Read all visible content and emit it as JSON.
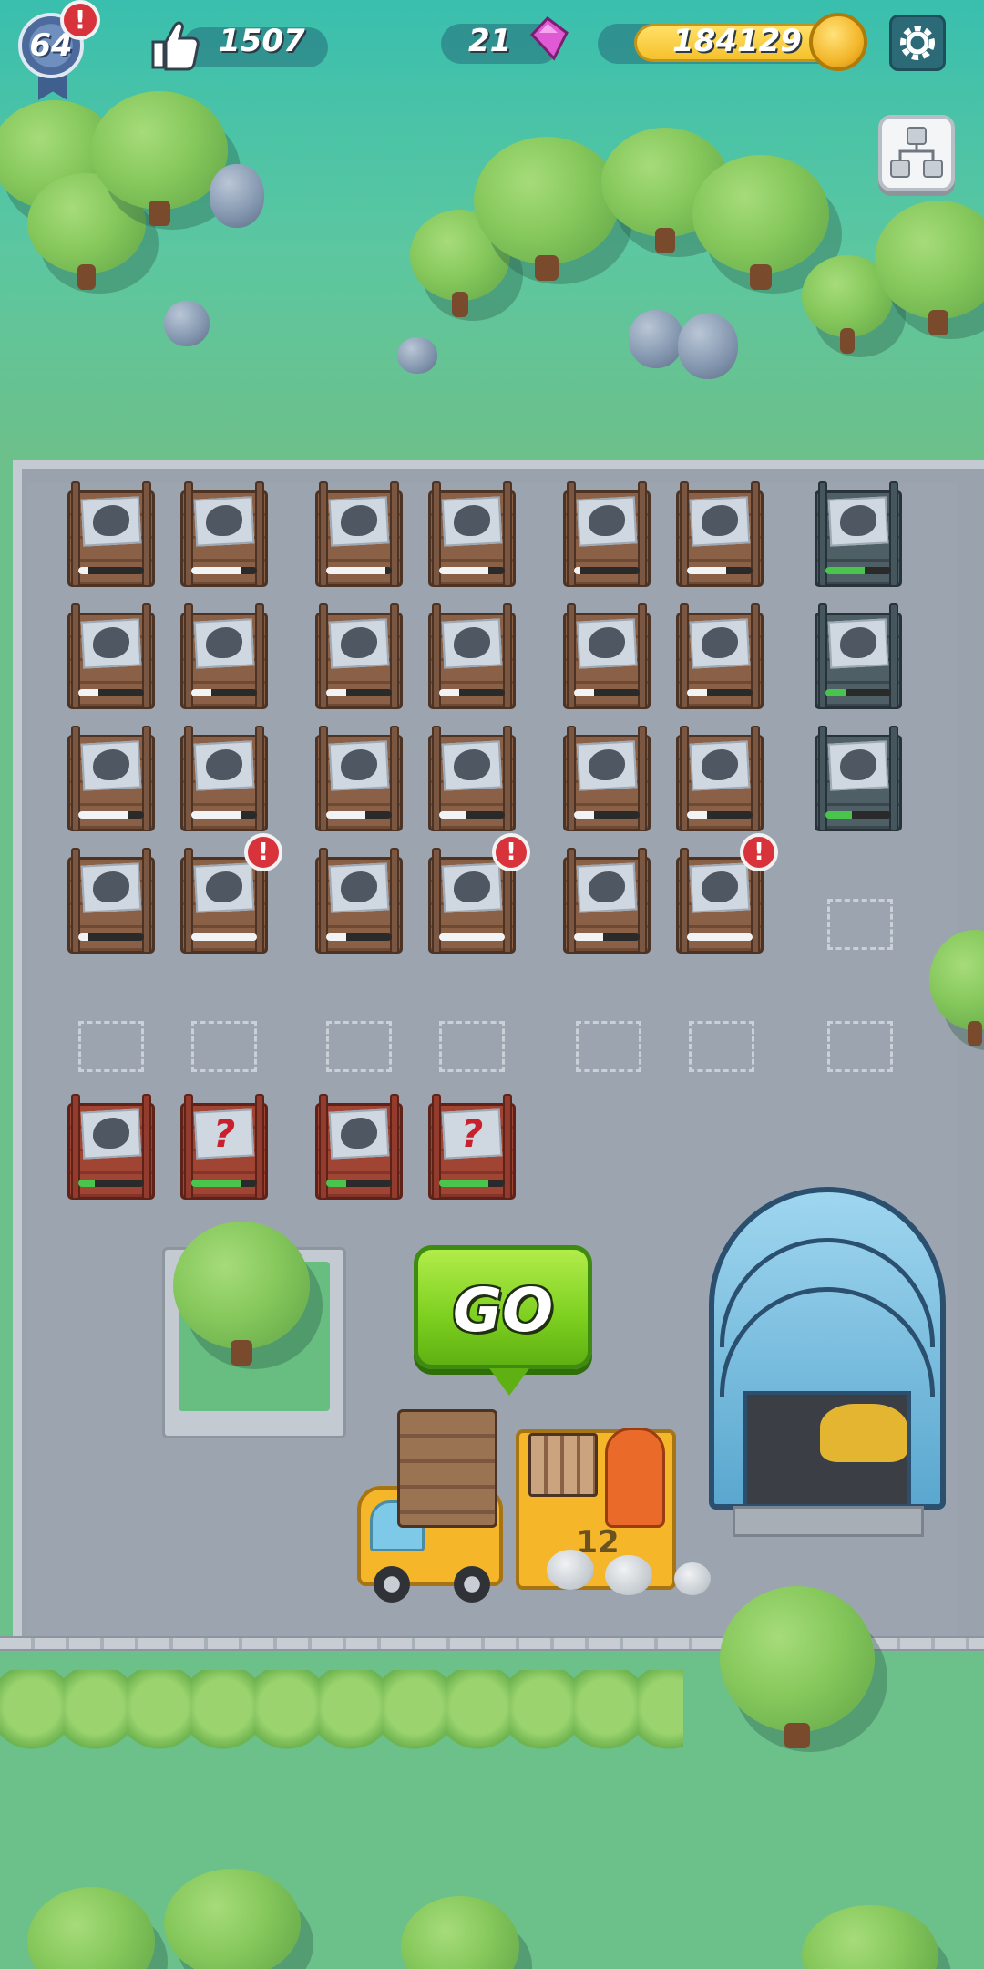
{
  "hud": {
    "level": "64",
    "level_alert": "!",
    "likes": "1507",
    "gems": "21",
    "coins": "184129"
  },
  "icons": {
    "likes": "thumbs-up-icon",
    "gems": "pink-gem-icon",
    "coins": "gold-coin-icon",
    "settings": "gear-icon",
    "map": "skill-tree-icon"
  },
  "colors": {
    "go_button": "#7ccf1f",
    "coin_bar": "#f5c12c",
    "gem": "#e05ad6",
    "alert": "#d8323b",
    "progress_green": "#49c44d"
  },
  "crates": {
    "alert_mark": "!",
    "unknown_mark": "?",
    "rows": [
      [
        {
          "style": "wood",
          "progress": 0.15,
          "alert": false
        },
        {
          "style": "wood",
          "progress": 0.75,
          "alert": false
        },
        {
          "style": "wood",
          "progress": 0.9,
          "alert": false
        },
        {
          "style": "wood",
          "progress": 0.75,
          "alert": false
        },
        {
          "style": "wood",
          "progress": 0.1,
          "alert": false
        },
        {
          "style": "wood",
          "progress": 0.6,
          "alert": false
        },
        {
          "style": "dark",
          "progress": 0.6,
          "alert": false
        }
      ],
      [
        {
          "style": "wood",
          "progress": 0.3,
          "alert": false
        },
        {
          "style": "wood",
          "progress": 0.3,
          "alert": false
        },
        {
          "style": "wood",
          "progress": 0.3,
          "alert": false
        },
        {
          "style": "wood",
          "progress": 0.3,
          "alert": false
        },
        {
          "style": "wood",
          "progress": 0.3,
          "alert": false
        },
        {
          "style": "wood",
          "progress": 0.3,
          "alert": false
        },
        {
          "style": "dark",
          "progress": 0.3,
          "alert": false
        }
      ],
      [
        {
          "style": "wood",
          "progress": 0.75,
          "alert": false
        },
        {
          "style": "wood",
          "progress": 0.75,
          "alert": false
        },
        {
          "style": "wood",
          "progress": 0.6,
          "alert": false
        },
        {
          "style": "wood",
          "progress": 0.4,
          "alert": false
        },
        {
          "style": "wood",
          "progress": 0.3,
          "alert": false
        },
        {
          "style": "wood",
          "progress": 0.3,
          "alert": false
        },
        {
          "style": "dark",
          "progress": 0.4,
          "alert": false
        }
      ],
      [
        {
          "style": "wood",
          "progress": 0.15,
          "alert": false
        },
        {
          "style": "wood",
          "progress": 1.0,
          "alert": true
        },
        {
          "style": "wood",
          "progress": 0.3,
          "alert": false
        },
        {
          "style": "wood",
          "progress": 1.0,
          "alert": true
        },
        {
          "style": "wood",
          "progress": 0.45,
          "alert": false
        },
        {
          "style": "wood",
          "progress": 1.0,
          "alert": true
        }
      ]
    ],
    "incoming": [
      {
        "style": "red",
        "progress": 0.25,
        "mystery": false
      },
      {
        "style": "red",
        "progress": 0.75,
        "mystery": true
      },
      {
        "style": "red",
        "progress": 0.3,
        "mystery": false
      },
      {
        "style": "red",
        "progress": 0.75,
        "mystery": true
      }
    ]
  },
  "go_button": {
    "label": "GO"
  },
  "truck": {
    "number": "12"
  }
}
